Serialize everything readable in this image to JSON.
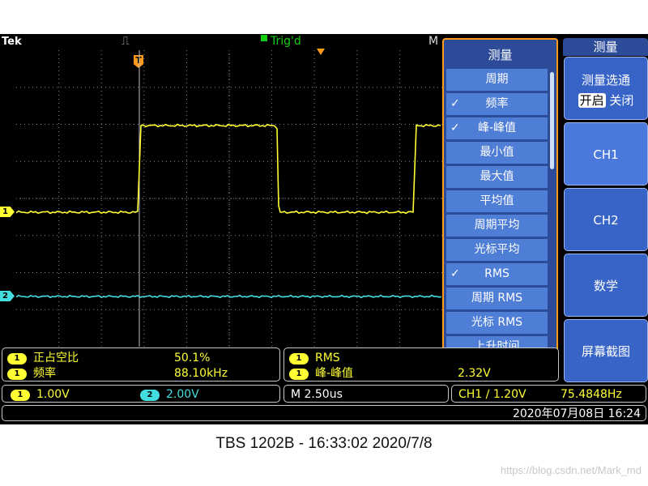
{
  "scope": {
    "brand": "Tek",
    "trigger_status": "Trig'd",
    "mode_letter": "M",
    "acq_icon": "acquire-run-icon",
    "channel_markers": [
      "1",
      "2"
    ],
    "trigger_position_marker": "T"
  },
  "measure_menu": {
    "title": "测量",
    "items": [
      {
        "label": "周期",
        "checked": false
      },
      {
        "label": "频率",
        "checked": true
      },
      {
        "label": "峰-峰值",
        "checked": true
      },
      {
        "label": "最小值",
        "checked": false
      },
      {
        "label": "最大值",
        "checked": false
      },
      {
        "label": "平均值",
        "checked": false
      },
      {
        "label": "周期平均",
        "checked": false
      },
      {
        "label": "光标平均",
        "checked": false
      },
      {
        "label": "RMS",
        "checked": true
      },
      {
        "label": "周期 RMS",
        "checked": false
      },
      {
        "label": "光标 RMS",
        "checked": false
      },
      {
        "label": "上升时间",
        "checked": false
      }
    ],
    "check_glyph": "✓"
  },
  "softkeys": {
    "title": "测量",
    "select_label": "测量选通",
    "on_label": "开启",
    "off_label": "关闭",
    "ch1": "CH1",
    "ch2": "CH2",
    "math": "数学",
    "screenshot": "屏幕截图"
  },
  "measurements": {
    "left": [
      {
        "ch": "1",
        "name": "正占空比",
        "value": "50.1%"
      },
      {
        "ch": "1",
        "name": "频率",
        "value": "88.10kHz"
      }
    ],
    "right": [
      {
        "ch": "1",
        "name": "RMS",
        "value": ""
      },
      {
        "ch": "1",
        "name": "峰-峰值",
        "value": "2.32V"
      }
    ]
  },
  "status": {
    "ch1_badge": "1",
    "ch1_scale": "1.00V",
    "ch2_badge": "2",
    "ch2_scale": "2.00V",
    "timebase": "M 2.50us",
    "trigger": "CH1 ∕ 1.20V",
    "trigger_freq": "75.4848Hz",
    "datetime": "2020年07月08日 16:24"
  },
  "colors": {
    "ch1": "#ffff33",
    "ch2": "#44dde0",
    "trigger": "#ff9a1a",
    "trig_ok": "#11d011",
    "menu_bg": "#2c4c9a",
    "menu_item": "#4f7ed6"
  },
  "caption": "TBS 1202B - 16:33:02   2020/7/8",
  "watermark": "https://blog.csdn.net/Mark_md"
}
